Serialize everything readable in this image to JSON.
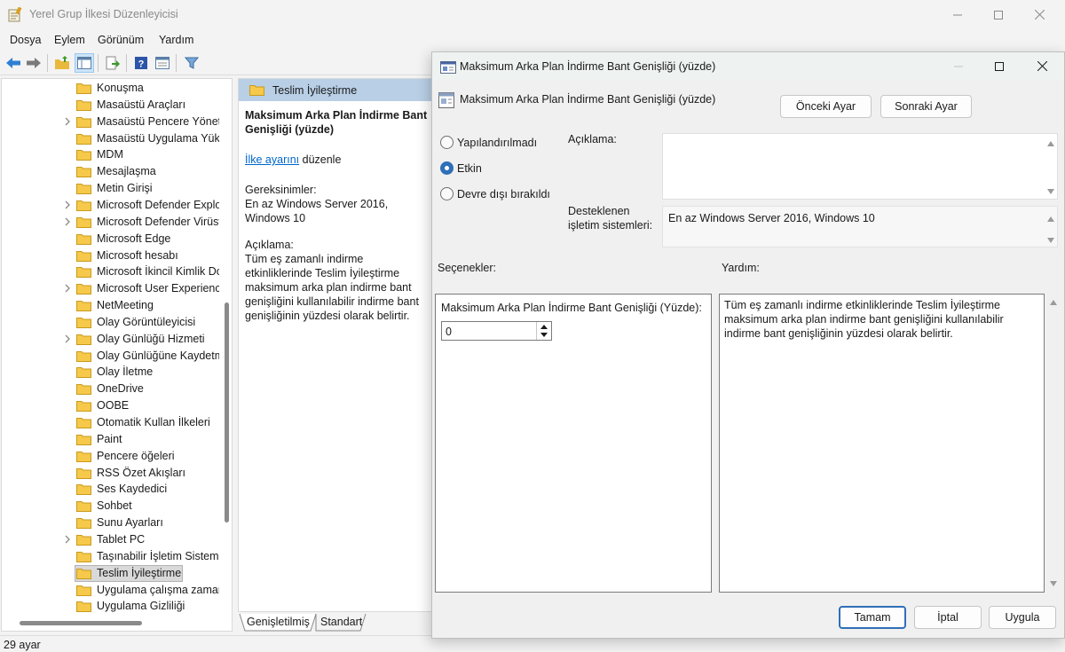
{
  "window": {
    "title": "Yerel Grup İlkesi Düzenleyicisi"
  },
  "menu": [
    "Dosya",
    "Eylem",
    "Görünüm",
    "Yardım"
  ],
  "toolbar_icons": [
    "back-arrow-icon",
    "forward-arrow-icon",
    "up-folder-icon",
    "show-hide-tree-icon",
    "export-list-icon",
    "help-icon",
    "properties-icon",
    "filter-icon"
  ],
  "tree": {
    "items": [
      {
        "label": "Konuşma",
        "expandable": false
      },
      {
        "label": "Masaüstü Araçları",
        "expandable": false
      },
      {
        "label": "Masaüstü Pencere Yöneticisi",
        "expandable": true
      },
      {
        "label": "Masaüstü Uygulama Yükleyici",
        "expandable": false
      },
      {
        "label": "MDM",
        "expandable": false
      },
      {
        "label": "Mesajlaşma",
        "expandable": false
      },
      {
        "label": "Metin Girişi",
        "expandable": false
      },
      {
        "label": "Microsoft Defender Exploit Guard",
        "expandable": true
      },
      {
        "label": "Microsoft Defender Virüsten Koruma",
        "expandable": true
      },
      {
        "label": "Microsoft Edge",
        "expandable": false
      },
      {
        "label": "Microsoft hesabı",
        "expandable": false
      },
      {
        "label": "Microsoft İkincil Kimlik Doğrulama",
        "expandable": false
      },
      {
        "label": "Microsoft User Experience",
        "expandable": true
      },
      {
        "label": "NetMeeting",
        "expandable": false
      },
      {
        "label": "Olay Görüntüleyicisi",
        "expandable": false
      },
      {
        "label": "Olay Günlüğü Hizmeti",
        "expandable": true
      },
      {
        "label": "Olay Günlüğüne Kaydetme",
        "expandable": false
      },
      {
        "label": "Olay İletme",
        "expandable": false
      },
      {
        "label": "OneDrive",
        "expandable": false
      },
      {
        "label": "OOBE",
        "expandable": false
      },
      {
        "label": "Otomatik Kullan İlkeleri",
        "expandable": false
      },
      {
        "label": "Paint",
        "expandable": false
      },
      {
        "label": "Pencere öğeleri",
        "expandable": false
      },
      {
        "label": "RSS Özet Akışları",
        "expandable": false
      },
      {
        "label": "Ses Kaydedici",
        "expandable": false
      },
      {
        "label": "Sohbet",
        "expandable": false
      },
      {
        "label": "Sunu Ayarları",
        "expandable": false
      },
      {
        "label": "Tablet PC",
        "expandable": true
      },
      {
        "label": "Taşınabilir İşletim Sistemi",
        "expandable": false
      },
      {
        "label": "Teslim İyileştirme",
        "expandable": false,
        "selected": true
      },
      {
        "label": "Uygulama çalışma zamanı",
        "expandable": false
      },
      {
        "label": "Uygulama Gizliliği",
        "expandable": false
      }
    ]
  },
  "details": {
    "header": "Teslim İyileştirme",
    "policy_title": "Maksimum Arka Plan İndirme Bant Genişliği (yüzde)",
    "edit_link": "İlke ayarını",
    "edit_suffix": " düzenle",
    "requirements_label": "Gereksinimler:",
    "requirements_text": "En az Windows Server 2016, Windows 10",
    "description_label": "Açıklama:",
    "description_text": "Tüm eş zamanlı indirme etkinliklerinde Teslim İyileştirme maksimum arka plan indirme bant genişliğini kullanılabilir indirme bant genişliğinin yüzdesi olarak belirtir.",
    "tabs": [
      "Genişletilmiş",
      "Standart"
    ]
  },
  "status": "29 ayar",
  "dialog": {
    "title": "Maksimum Arka Plan İndirme Bant Genişliği (yüzde)",
    "policy_name": "Maksimum Arka Plan İndirme Bant Genişliği (yüzde)",
    "prev_button": "Önceki Ayar",
    "next_button": "Sonraki Ayar",
    "radios": {
      "not_configured": "Yapılandırılmadı",
      "enabled": "Etkin",
      "disabled": "Devre dışı bırakıldı",
      "selected": "enabled"
    },
    "comment_label": "Açıklama:",
    "comment_value": "",
    "supported_label": "Desteklenen işletim sistemleri:",
    "supported_value": "En az Windows Server 2016, Windows 10",
    "options_label": "Seçenekler:",
    "help_label": "Yardım:",
    "option_field_label": "Maksimum Arka Plan İndirme Bant Genişliği (Yüzde):",
    "option_field_value": "0",
    "help_text": "Tüm eş zamanlı indirme etkinliklerinde Teslim İyileştirme maksimum arka plan indirme bant genişliğini kullanılabilir indirme bant genişliğinin yüzdesi olarak belirtir.",
    "ok_button": "Tamam",
    "cancel_button": "İptal",
    "apply_button": "Uygula"
  },
  "colors": {
    "accent": "#2f6fb8",
    "selection": "#b9cfe6",
    "link": "#0066cc",
    "folder": "#f6c94a"
  }
}
